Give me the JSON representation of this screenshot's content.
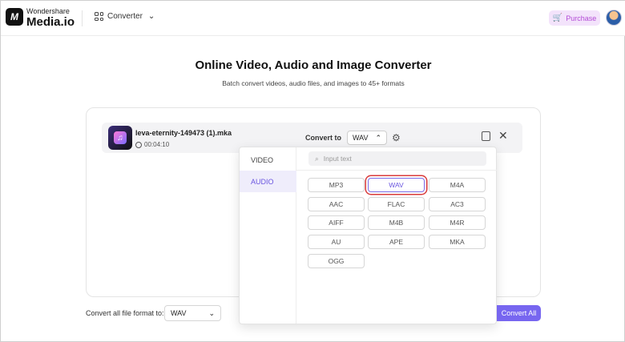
{
  "header": {
    "brand_top": "Wondershare",
    "brand_bottom": "Media.io",
    "menu_label": "Converter",
    "purchase_label": "Purchase"
  },
  "page": {
    "title": "Online Video, Audio and Image Converter",
    "subtitle": "Batch convert videos, audio files, and images to 45+ formats"
  },
  "file": {
    "name": "leva-eternity-149473 (1).mka",
    "duration": "00:04:10",
    "convert_to_label": "Convert to",
    "selected_format": "WAV"
  },
  "dropdown": {
    "tabs": [
      "VIDEO",
      "AUDIO"
    ],
    "active_tab": "AUDIO",
    "search_placeholder": "Input text",
    "formats": [
      "MP3",
      "WAV",
      "M4A",
      "AAC",
      "FLAC",
      "AC3",
      "AIFF",
      "M4B",
      "M4R",
      "AU",
      "APE",
      "MKA",
      "OGG"
    ],
    "selected_format": "WAV"
  },
  "footer": {
    "label": "Convert all file format to:",
    "format": "WAV",
    "convert_all_label": "Convert All"
  },
  "colors": {
    "accent": "#7766f0",
    "purchase_bg": "#f3e3fb",
    "purchase_text": "#b34bd6",
    "highlight_box": "#d93a3a"
  }
}
